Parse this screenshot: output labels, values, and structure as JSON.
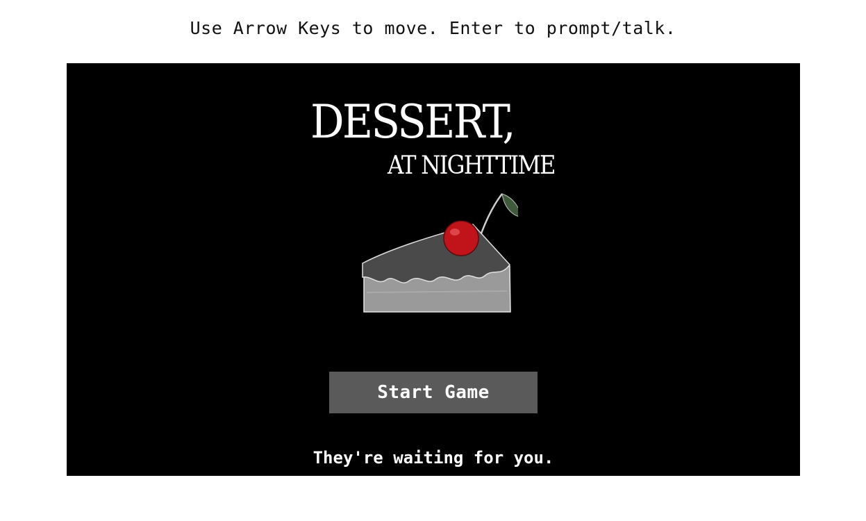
{
  "instructions": "Use Arrow Keys to move. Enter to prompt/talk.",
  "game": {
    "title": "DESSERT,",
    "subtitle": "AT NIGHTTIME",
    "start_label": "Start Game",
    "tagline": "They're waiting for you."
  },
  "colors": {
    "canvas_bg": "#000000",
    "button_bg": "#5a5a5a",
    "cherry": "#c0141a",
    "leaf": "#3f5a3a",
    "cake_top": "#4a4a4a",
    "cake_body": "#9a9a9a"
  },
  "icons": {
    "cake": "cake-slice-with-cherry-icon"
  }
}
